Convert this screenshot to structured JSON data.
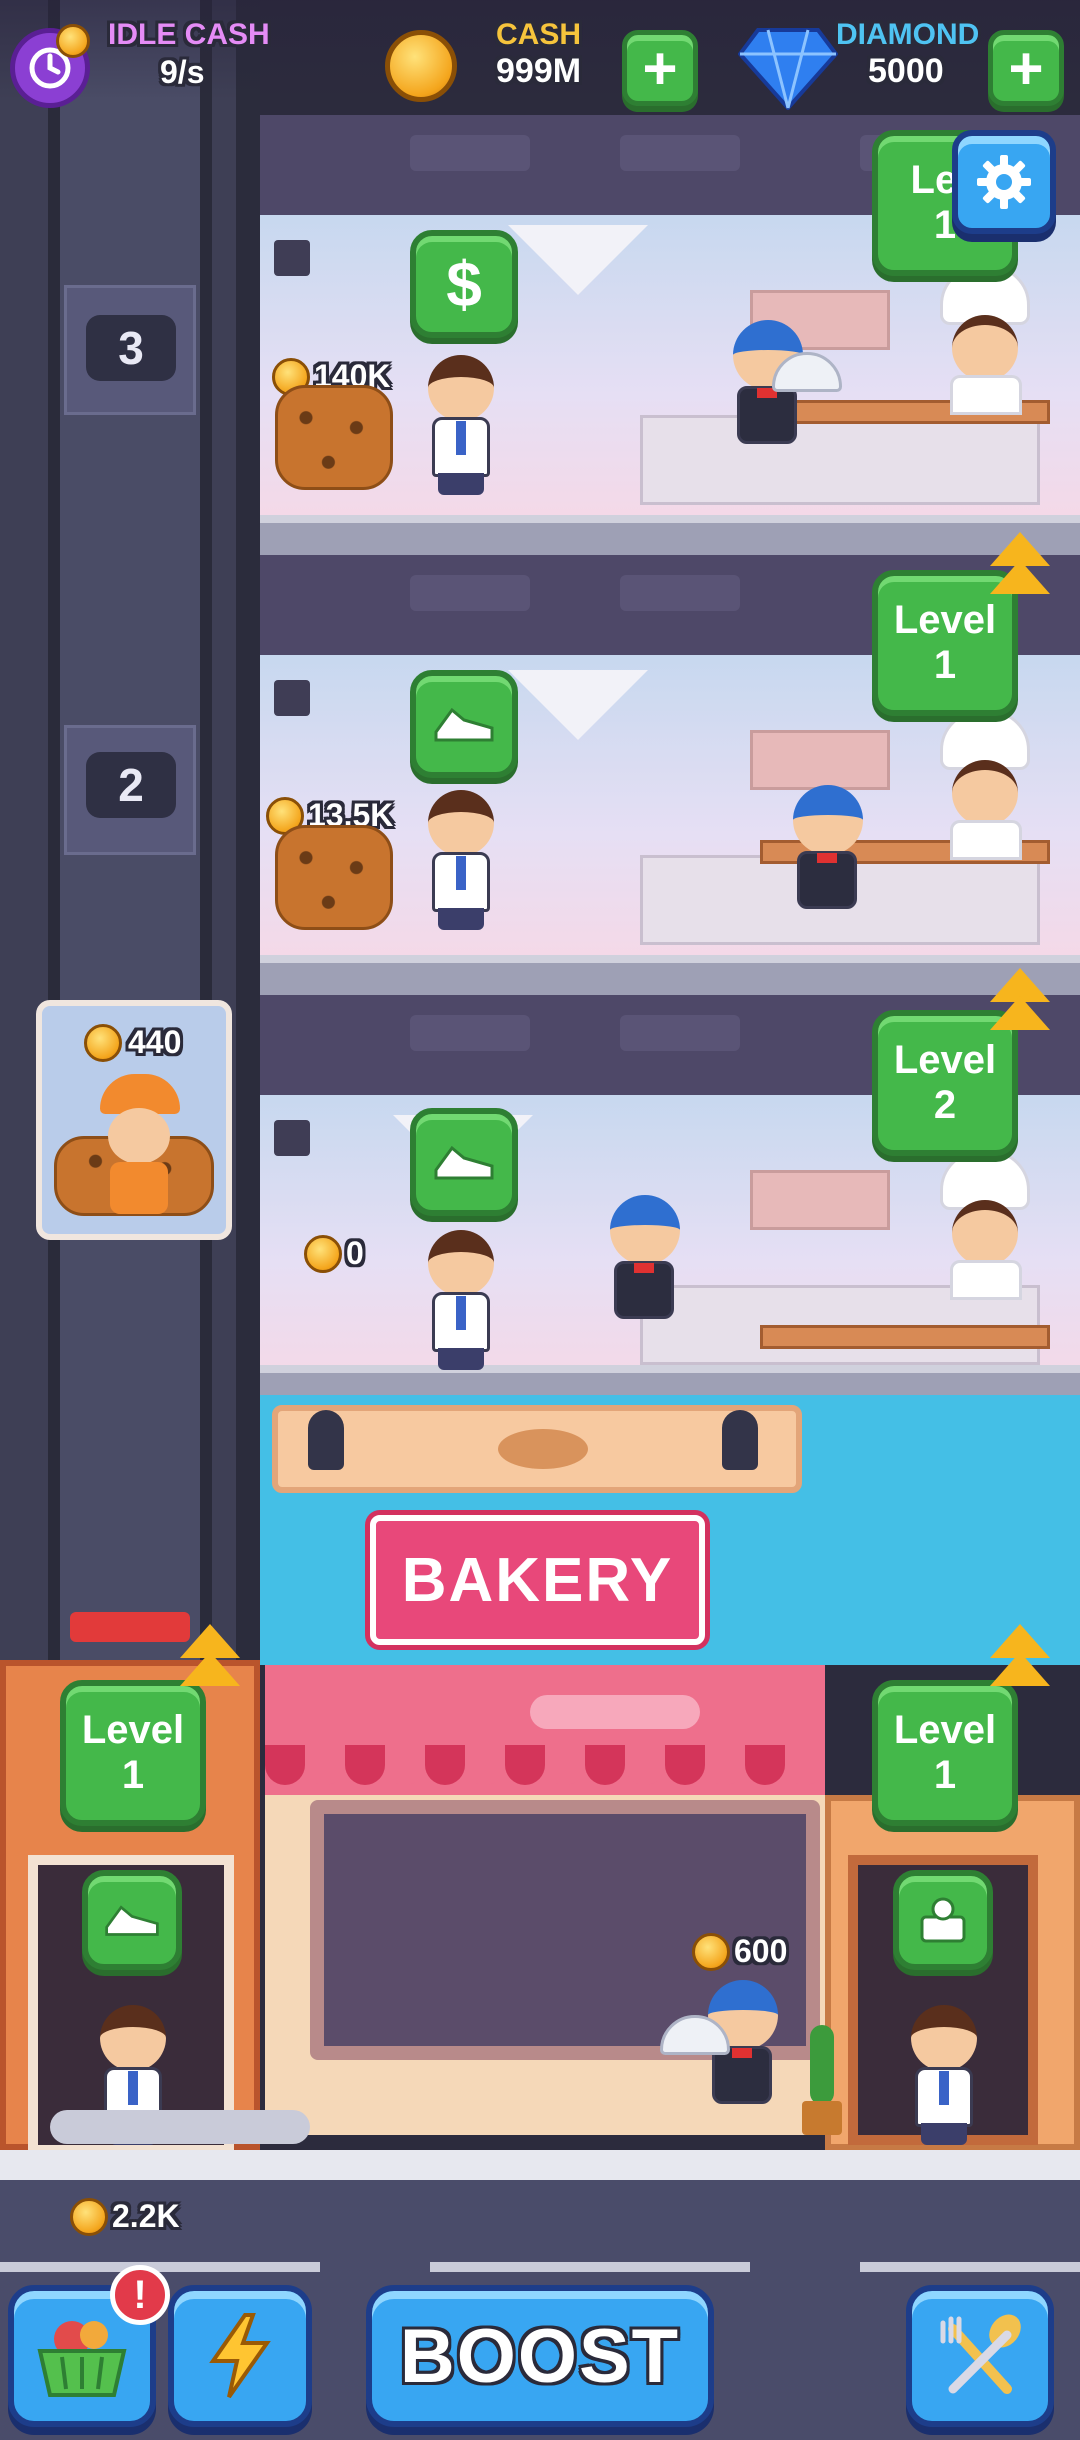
{
  "hud": {
    "idle_cash_label": "IDLE CASH",
    "idle_cash_value": "9/s",
    "cash_label": "CASH",
    "cash_value": "999M",
    "diamond_label": "DIAMOND",
    "diamond_value": "5000"
  },
  "settings": {
    "partial_label": "Lev",
    "partial_level": "1"
  },
  "shaft": {
    "floor_numbers": [
      "3",
      "2"
    ],
    "elevator_amount": "440"
  },
  "floors": [
    {
      "stock": "140K",
      "level_label": "",
      "level_value": ""
    },
    {
      "stock": "13.5K",
      "level_label": "Level",
      "level_value": "1"
    },
    {
      "stock": "0",
      "level_label": "Level",
      "level_value": "2"
    }
  ],
  "bakery": {
    "sign_text": "BAKERY",
    "elevator_level_label": "Level",
    "elevator_level_value": "1",
    "shop_level_label": "Level",
    "shop_level_value": "1",
    "waiter_amount": "600"
  },
  "bottom": {
    "ground_cash": "2.2K",
    "alert_badge": "!",
    "boost_label": "BOOST"
  },
  "colors": {
    "green": "#44b84a",
    "blue": "#38a6f2",
    "gold": "#f4a51c",
    "sky": "#44bfe6"
  }
}
